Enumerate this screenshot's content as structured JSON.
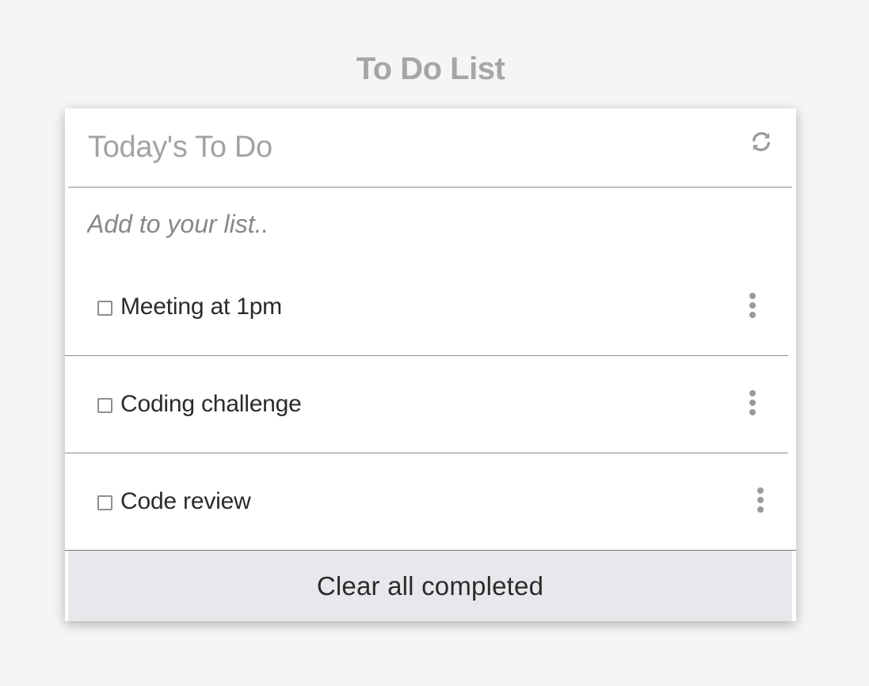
{
  "page": {
    "title": "To Do List"
  },
  "card": {
    "title": "Today's To Do",
    "refresh_icon": "refresh-icon",
    "add_placeholder": "Add to your list..",
    "items": [
      {
        "label": "Meeting at 1pm",
        "checked": false,
        "menu_icon": "more-vertical-icon"
      },
      {
        "label": "Coding challenge",
        "checked": false,
        "menu_icon": "more-vertical-icon"
      },
      {
        "label": "Code review",
        "checked": false,
        "menu_icon": "more-vertical-icon"
      }
    ],
    "clear_button": "Clear all completed"
  },
  "colors": {
    "background": "#f5f5f5",
    "card": "#ffffff",
    "muted_text": "#a6a6a6",
    "item_text": "#2b2b2b",
    "footer_button": "#e8e8ec"
  }
}
